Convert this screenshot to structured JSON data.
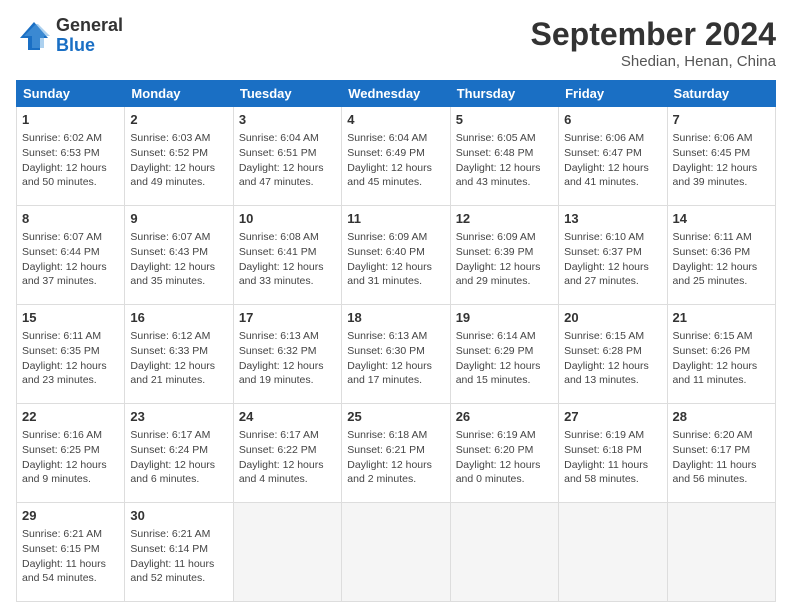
{
  "logo": {
    "general": "General",
    "blue": "Blue"
  },
  "title": "September 2024",
  "subtitle": "Shedian, Henan, China",
  "days_header": [
    "Sunday",
    "Monday",
    "Tuesday",
    "Wednesday",
    "Thursday",
    "Friday",
    "Saturday"
  ],
  "weeks": [
    [
      {
        "day": "1",
        "sunrise": "6:02 AM",
        "sunset": "6:53 PM",
        "daylight": "12 hours and 50 minutes."
      },
      {
        "day": "2",
        "sunrise": "6:03 AM",
        "sunset": "6:52 PM",
        "daylight": "12 hours and 49 minutes."
      },
      {
        "day": "3",
        "sunrise": "6:04 AM",
        "sunset": "6:51 PM",
        "daylight": "12 hours and 47 minutes."
      },
      {
        "day": "4",
        "sunrise": "6:04 AM",
        "sunset": "6:49 PM",
        "daylight": "12 hours and 45 minutes."
      },
      {
        "day": "5",
        "sunrise": "6:05 AM",
        "sunset": "6:48 PM",
        "daylight": "12 hours and 43 minutes."
      },
      {
        "day": "6",
        "sunrise": "6:06 AM",
        "sunset": "6:47 PM",
        "daylight": "12 hours and 41 minutes."
      },
      {
        "day": "7",
        "sunrise": "6:06 AM",
        "sunset": "6:45 PM",
        "daylight": "12 hours and 39 minutes."
      }
    ],
    [
      {
        "day": "8",
        "sunrise": "6:07 AM",
        "sunset": "6:44 PM",
        "daylight": "12 hours and 37 minutes."
      },
      {
        "day": "9",
        "sunrise": "6:07 AM",
        "sunset": "6:43 PM",
        "daylight": "12 hours and 35 minutes."
      },
      {
        "day": "10",
        "sunrise": "6:08 AM",
        "sunset": "6:41 PM",
        "daylight": "12 hours and 33 minutes."
      },
      {
        "day": "11",
        "sunrise": "6:09 AM",
        "sunset": "6:40 PM",
        "daylight": "12 hours and 31 minutes."
      },
      {
        "day": "12",
        "sunrise": "6:09 AM",
        "sunset": "6:39 PM",
        "daylight": "12 hours and 29 minutes."
      },
      {
        "day": "13",
        "sunrise": "6:10 AM",
        "sunset": "6:37 PM",
        "daylight": "12 hours and 27 minutes."
      },
      {
        "day": "14",
        "sunrise": "6:11 AM",
        "sunset": "6:36 PM",
        "daylight": "12 hours and 25 minutes."
      }
    ],
    [
      {
        "day": "15",
        "sunrise": "6:11 AM",
        "sunset": "6:35 PM",
        "daylight": "12 hours and 23 minutes."
      },
      {
        "day": "16",
        "sunrise": "6:12 AM",
        "sunset": "6:33 PM",
        "daylight": "12 hours and 21 minutes."
      },
      {
        "day": "17",
        "sunrise": "6:13 AM",
        "sunset": "6:32 PM",
        "daylight": "12 hours and 19 minutes."
      },
      {
        "day": "18",
        "sunrise": "6:13 AM",
        "sunset": "6:30 PM",
        "daylight": "12 hours and 17 minutes."
      },
      {
        "day": "19",
        "sunrise": "6:14 AM",
        "sunset": "6:29 PM",
        "daylight": "12 hours and 15 minutes."
      },
      {
        "day": "20",
        "sunrise": "6:15 AM",
        "sunset": "6:28 PM",
        "daylight": "12 hours and 13 minutes."
      },
      {
        "day": "21",
        "sunrise": "6:15 AM",
        "sunset": "6:26 PM",
        "daylight": "12 hours and 11 minutes."
      }
    ],
    [
      {
        "day": "22",
        "sunrise": "6:16 AM",
        "sunset": "6:25 PM",
        "daylight": "12 hours and 9 minutes."
      },
      {
        "day": "23",
        "sunrise": "6:17 AM",
        "sunset": "6:24 PM",
        "daylight": "12 hours and 6 minutes."
      },
      {
        "day": "24",
        "sunrise": "6:17 AM",
        "sunset": "6:22 PM",
        "daylight": "12 hours and 4 minutes."
      },
      {
        "day": "25",
        "sunrise": "6:18 AM",
        "sunset": "6:21 PM",
        "daylight": "12 hours and 2 minutes."
      },
      {
        "day": "26",
        "sunrise": "6:19 AM",
        "sunset": "6:20 PM",
        "daylight": "12 hours and 0 minutes."
      },
      {
        "day": "27",
        "sunrise": "6:19 AM",
        "sunset": "6:18 PM",
        "daylight": "11 hours and 58 minutes."
      },
      {
        "day": "28",
        "sunrise": "6:20 AM",
        "sunset": "6:17 PM",
        "daylight": "11 hours and 56 minutes."
      }
    ],
    [
      {
        "day": "29",
        "sunrise": "6:21 AM",
        "sunset": "6:15 PM",
        "daylight": "11 hours and 54 minutes."
      },
      {
        "day": "30",
        "sunrise": "6:21 AM",
        "sunset": "6:14 PM",
        "daylight": "11 hours and 52 minutes."
      },
      null,
      null,
      null,
      null,
      null
    ]
  ]
}
